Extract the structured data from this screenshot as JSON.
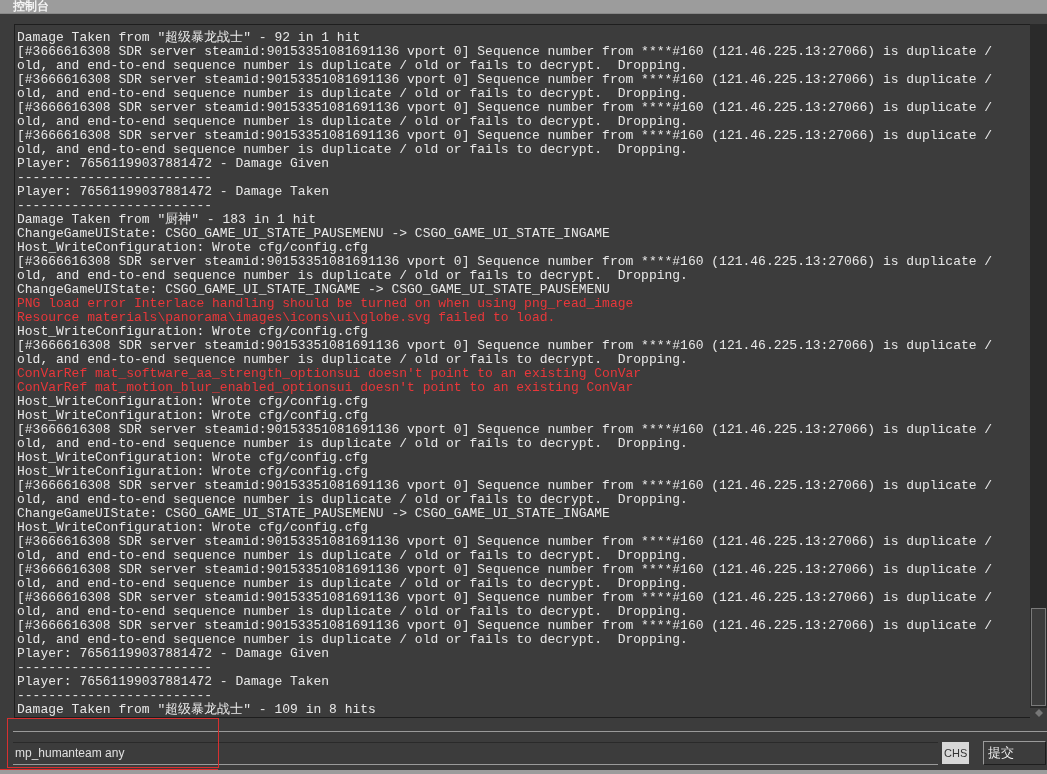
{
  "window": {
    "title": "控制台"
  },
  "log": [
    {
      "kind": "info",
      "text": "Damage Taken from \"超级暴龙战士\" - 92 in 1 hit"
    },
    {
      "kind": "info",
      "text": "[#3666616308 SDR server steamid:90153351081691136 vport 0] Sequence number from ****#160 (121.46.225.13:27066) is duplicate /"
    },
    {
      "kind": "info",
      "text": "old, and end-to-end sequence number is duplicate / old or fails to decrypt.  Dropping."
    },
    {
      "kind": "info",
      "text": "[#3666616308 SDR server steamid:90153351081691136 vport 0] Sequence number from ****#160 (121.46.225.13:27066) is duplicate /"
    },
    {
      "kind": "info",
      "text": "old, and end-to-end sequence number is duplicate / old or fails to decrypt.  Dropping."
    },
    {
      "kind": "info",
      "text": "[#3666616308 SDR server steamid:90153351081691136 vport 0] Sequence number from ****#160 (121.46.225.13:27066) is duplicate /"
    },
    {
      "kind": "info",
      "text": "old, and end-to-end sequence number is duplicate / old or fails to decrypt.  Dropping."
    },
    {
      "kind": "info",
      "text": "[#3666616308 SDR server steamid:90153351081691136 vport 0] Sequence number from ****#160 (121.46.225.13:27066) is duplicate /"
    },
    {
      "kind": "info",
      "text": "old, and end-to-end sequence number is duplicate / old or fails to decrypt.  Dropping."
    },
    {
      "kind": "info",
      "text": "Player: 76561199037881472 - Damage Given"
    },
    {
      "kind": "info",
      "text": "-------------------------"
    },
    {
      "kind": "info",
      "text": "Player: 76561199037881472 - Damage Taken"
    },
    {
      "kind": "info",
      "text": "-------------------------"
    },
    {
      "kind": "info",
      "text": "Damage Taken from \"厨神\" - 183 in 1 hit"
    },
    {
      "kind": "info",
      "text": "ChangeGameUIState: CSGO_GAME_UI_STATE_PAUSEMENU -> CSGO_GAME_UI_STATE_INGAME"
    },
    {
      "kind": "info",
      "text": "Host_WriteConfiguration: Wrote cfg/config.cfg"
    },
    {
      "kind": "info",
      "text": "[#3666616308 SDR server steamid:90153351081691136 vport 0] Sequence number from ****#160 (121.46.225.13:27066) is duplicate /"
    },
    {
      "kind": "info",
      "text": "old, and end-to-end sequence number is duplicate / old or fails to decrypt.  Dropping."
    },
    {
      "kind": "info",
      "text": "ChangeGameUIState: CSGO_GAME_UI_STATE_INGAME -> CSGO_GAME_UI_STATE_PAUSEMENU"
    },
    {
      "kind": "error",
      "text": "PNG load error Interlace handling should be turned on when using png_read_image"
    },
    {
      "kind": "error",
      "text": "Resource materials\\panorama\\images\\icons\\ui\\globe.svg failed to load."
    },
    {
      "kind": "info",
      "text": "Host_WriteConfiguration: Wrote cfg/config.cfg"
    },
    {
      "kind": "info",
      "text": "[#3666616308 SDR server steamid:90153351081691136 vport 0] Sequence number from ****#160 (121.46.225.13:27066) is duplicate /"
    },
    {
      "kind": "info",
      "text": "old, and end-to-end sequence number is duplicate / old or fails to decrypt.  Dropping."
    },
    {
      "kind": "error",
      "text": "ConVarRef mat_software_aa_strength_optionsui doesn't point to an existing ConVar"
    },
    {
      "kind": "error",
      "text": "ConVarRef mat_motion_blur_enabled_optionsui doesn't point to an existing ConVar"
    },
    {
      "kind": "info",
      "text": "Host_WriteConfiguration: Wrote cfg/config.cfg"
    },
    {
      "kind": "info",
      "text": "Host_WriteConfiguration: Wrote cfg/config.cfg"
    },
    {
      "kind": "info",
      "text": "[#3666616308 SDR server steamid:90153351081691136 vport 0] Sequence number from ****#160 (121.46.225.13:27066) is duplicate /"
    },
    {
      "kind": "info",
      "text": "old, and end-to-end sequence number is duplicate / old or fails to decrypt.  Dropping."
    },
    {
      "kind": "info",
      "text": "Host_WriteConfiguration: Wrote cfg/config.cfg"
    },
    {
      "kind": "info",
      "text": "Host_WriteConfiguration: Wrote cfg/config.cfg"
    },
    {
      "kind": "info",
      "text": "[#3666616308 SDR server steamid:90153351081691136 vport 0] Sequence number from ****#160 (121.46.225.13:27066) is duplicate /"
    },
    {
      "kind": "info",
      "text": "old, and end-to-end sequence number is duplicate / old or fails to decrypt.  Dropping."
    },
    {
      "kind": "info",
      "text": "ChangeGameUIState: CSGO_GAME_UI_STATE_PAUSEMENU -> CSGO_GAME_UI_STATE_INGAME"
    },
    {
      "kind": "info",
      "text": "Host_WriteConfiguration: Wrote cfg/config.cfg"
    },
    {
      "kind": "info",
      "text": "[#3666616308 SDR server steamid:90153351081691136 vport 0] Sequence number from ****#160 (121.46.225.13:27066) is duplicate /"
    },
    {
      "kind": "info",
      "text": "old, and end-to-end sequence number is duplicate / old or fails to decrypt.  Dropping."
    },
    {
      "kind": "info",
      "text": "[#3666616308 SDR server steamid:90153351081691136 vport 0] Sequence number from ****#160 (121.46.225.13:27066) is duplicate /"
    },
    {
      "kind": "info",
      "text": "old, and end-to-end sequence number is duplicate / old or fails to decrypt.  Dropping."
    },
    {
      "kind": "info",
      "text": "[#3666616308 SDR server steamid:90153351081691136 vport 0] Sequence number from ****#160 (121.46.225.13:27066) is duplicate /"
    },
    {
      "kind": "info",
      "text": "old, and end-to-end sequence number is duplicate / old or fails to decrypt.  Dropping."
    },
    {
      "kind": "info",
      "text": "[#3666616308 SDR server steamid:90153351081691136 vport 0] Sequence number from ****#160 (121.46.225.13:27066) is duplicate /"
    },
    {
      "kind": "info",
      "text": "old, and end-to-end sequence number is duplicate / old or fails to decrypt.  Dropping."
    },
    {
      "kind": "info",
      "text": "Player: 76561199037881472 - Damage Given"
    },
    {
      "kind": "info",
      "text": "-------------------------"
    },
    {
      "kind": "info",
      "text": "Player: 76561199037881472 - Damage Taken"
    },
    {
      "kind": "info",
      "text": "-------------------------"
    },
    {
      "kind": "info",
      "text": "Damage Taken from \"超级暴龙战士\" - 109 in 8 hits"
    }
  ],
  "input": {
    "value": "mp_humanteam any"
  },
  "ime_indicator": "CHS",
  "submit_button": "提交"
}
